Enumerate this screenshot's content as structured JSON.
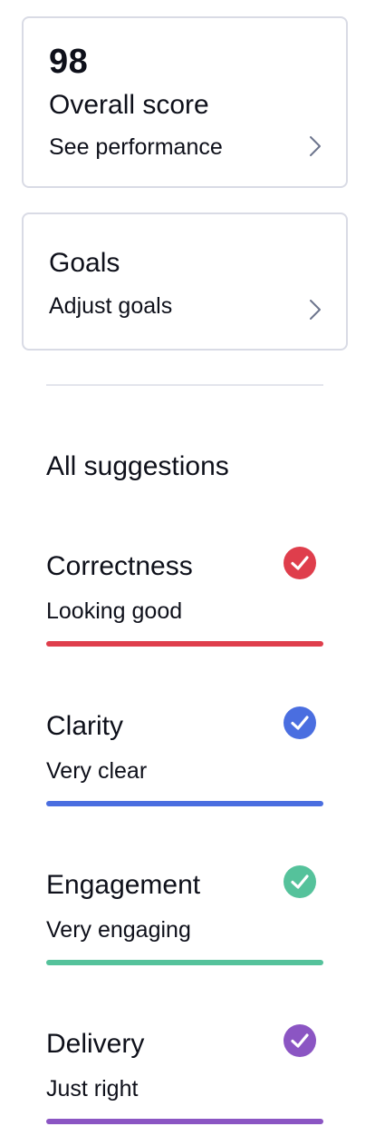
{
  "score_card": {
    "value": "98",
    "title": "Overall score",
    "link_label": "See performance",
    "icon": "chevron-right-icon"
  },
  "goals_card": {
    "title": "Goals",
    "link_label": "Adjust goals",
    "icon": "chevron-right-icon"
  },
  "suggestions": {
    "heading": "All suggestions",
    "items": [
      {
        "title": "Correctness",
        "status": "Looking good",
        "color": "#df3e4c",
        "icon": "check-circle-icon",
        "progress": 1.0
      },
      {
        "title": "Clarity",
        "status": "Very clear",
        "color": "#4a6ee0",
        "icon": "check-circle-icon",
        "progress": 1.0
      },
      {
        "title": "Engagement",
        "status": "Very engaging",
        "color": "#55c29b",
        "icon": "check-circle-icon",
        "progress": 1.0
      },
      {
        "title": "Delivery",
        "status": "Just right",
        "color": "#8b55c3",
        "icon": "check-circle-icon",
        "progress": 1.0
      }
    ]
  }
}
